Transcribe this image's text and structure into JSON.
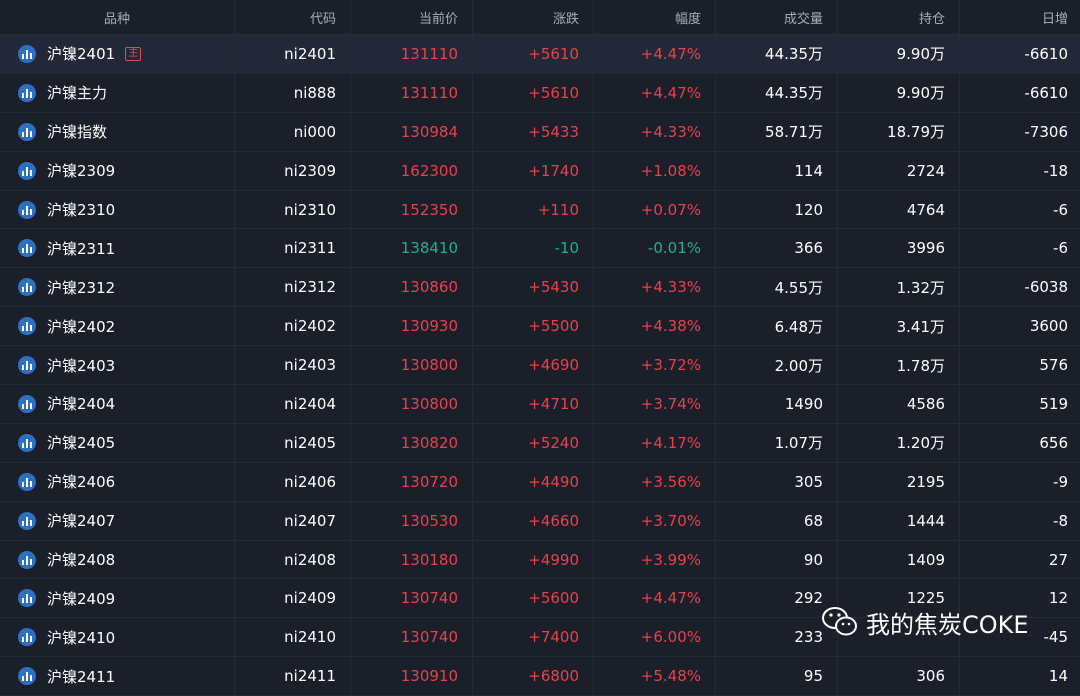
{
  "header": [
    "品种",
    "代码",
    "当前价",
    "涨跌",
    "幅度",
    "成交量",
    "持仓",
    "日增"
  ],
  "rows": [
    {
      "name": "沪镍2401",
      "badge": "主",
      "code": "ni2401",
      "price": "131110",
      "change": "+5610",
      "pct": "+4.47%",
      "volume": "44.35万",
      "oi": "9.90万",
      "daily": "-6610",
      "dir": "up",
      "selected": true
    },
    {
      "name": "沪镍主力",
      "badge": "",
      "code": "ni888",
      "price": "131110",
      "change": "+5610",
      "pct": "+4.47%",
      "volume": "44.35万",
      "oi": "9.90万",
      "daily": "-6610",
      "dir": "up"
    },
    {
      "name": "沪镍指数",
      "badge": "",
      "code": "ni000",
      "price": "130984",
      "change": "+5433",
      "pct": "+4.33%",
      "volume": "58.71万",
      "oi": "18.79万",
      "daily": "-7306",
      "dir": "up"
    },
    {
      "name": "沪镍2309",
      "badge": "",
      "code": "ni2309",
      "price": "162300",
      "change": "+1740",
      "pct": "+1.08%",
      "volume": "114",
      "oi": "2724",
      "daily": "-18",
      "dir": "up"
    },
    {
      "name": "沪镍2310",
      "badge": "",
      "code": "ni2310",
      "price": "152350",
      "change": "+110",
      "pct": "+0.07%",
      "volume": "120",
      "oi": "4764",
      "daily": "-6",
      "dir": "up"
    },
    {
      "name": "沪镍2311",
      "badge": "",
      "code": "ni2311",
      "price": "138410",
      "change": "-10",
      "pct": "-0.01%",
      "volume": "366",
      "oi": "3996",
      "daily": "-6",
      "dir": "down"
    },
    {
      "name": "沪镍2312",
      "badge": "",
      "code": "ni2312",
      "price": "130860",
      "change": "+5430",
      "pct": "+4.33%",
      "volume": "4.55万",
      "oi": "1.32万",
      "daily": "-6038",
      "dir": "up"
    },
    {
      "name": "沪镍2402",
      "badge": "",
      "code": "ni2402",
      "price": "130930",
      "change": "+5500",
      "pct": "+4.38%",
      "volume": "6.48万",
      "oi": "3.41万",
      "daily": "3600",
      "dir": "up"
    },
    {
      "name": "沪镍2403",
      "badge": "",
      "code": "ni2403",
      "price": "130800",
      "change": "+4690",
      "pct": "+3.72%",
      "volume": "2.00万",
      "oi": "1.78万",
      "daily": "576",
      "dir": "up"
    },
    {
      "name": "沪镍2404",
      "badge": "",
      "code": "ni2404",
      "price": "130800",
      "change": "+4710",
      "pct": "+3.74%",
      "volume": "1490",
      "oi": "4586",
      "daily": "519",
      "dir": "up"
    },
    {
      "name": "沪镍2405",
      "badge": "",
      "code": "ni2405",
      "price": "130820",
      "change": "+5240",
      "pct": "+4.17%",
      "volume": "1.07万",
      "oi": "1.20万",
      "daily": "656",
      "dir": "up"
    },
    {
      "name": "沪镍2406",
      "badge": "",
      "code": "ni2406",
      "price": "130720",
      "change": "+4490",
      "pct": "+3.56%",
      "volume": "305",
      "oi": "2195",
      "daily": "-9",
      "dir": "up"
    },
    {
      "name": "沪镍2407",
      "badge": "",
      "code": "ni2407",
      "price": "130530",
      "change": "+4660",
      "pct": "+3.70%",
      "volume": "68",
      "oi": "1444",
      "daily": "-8",
      "dir": "up"
    },
    {
      "name": "沪镍2408",
      "badge": "",
      "code": "ni2408",
      "price": "130180",
      "change": "+4990",
      "pct": "+3.99%",
      "volume": "90",
      "oi": "1409",
      "daily": "27",
      "dir": "up"
    },
    {
      "name": "沪镍2409",
      "badge": "",
      "code": "ni2409",
      "price": "130740",
      "change": "+5600",
      "pct": "+4.47%",
      "volume": "292",
      "oi": "1225",
      "daily": "12",
      "dir": "up"
    },
    {
      "name": "沪镍2410",
      "badge": "",
      "code": "ni2410",
      "price": "130740",
      "change": "+7400",
      "pct": "+6.00%",
      "volume": "233",
      "oi": "",
      "daily": "-45",
      "dir": "up"
    },
    {
      "name": "沪镍2411",
      "badge": "",
      "code": "ni2411",
      "price": "130910",
      "change": "+6800",
      "pct": "+5.48%",
      "volume": "95",
      "oi": "306",
      "daily": "14",
      "dir": "up"
    }
  ],
  "watermark": "我的焦炭COKE",
  "colors": {
    "up": "#e8414d",
    "down": "#19b38a",
    "background": "#1b1f2a"
  },
  "icons": {
    "row_icon": "bar-chart-icon",
    "watermark_icon": "wechat-icon"
  }
}
